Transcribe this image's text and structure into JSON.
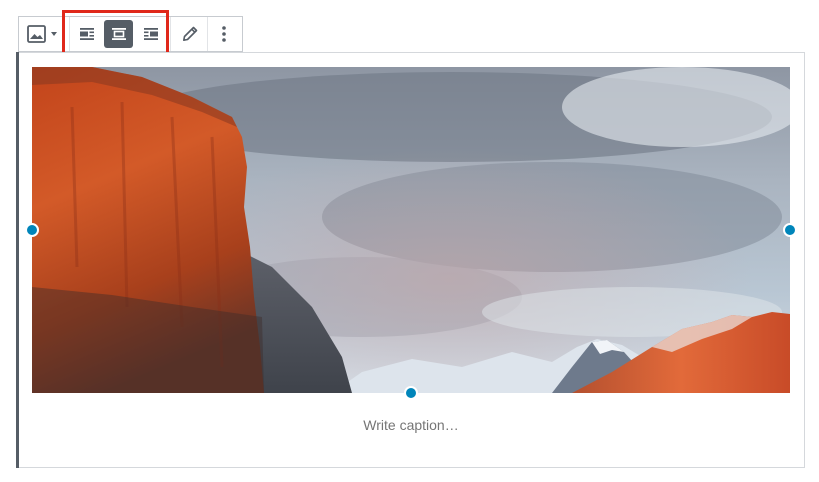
{
  "toolbar": {
    "buttons": [
      {
        "name": "change-image-type",
        "icon": "image-icon",
        "has_dropdown": true,
        "dropdown_icon": "caret-down-icon"
      },
      {
        "name": "align-left",
        "icon": "align-left-icon"
      },
      {
        "name": "align-center",
        "icon": "align-center-icon",
        "active": true
      },
      {
        "name": "align-right",
        "icon": "align-right-icon"
      },
      {
        "name": "edit-image",
        "icon": "pencil-icon"
      },
      {
        "name": "more-options",
        "icon": "vertical-ellipsis-icon"
      }
    ],
    "highlighted_group": "alignment-buttons"
  },
  "block": {
    "image_alt": "",
    "caption_placeholder": "Write caption…",
    "caption_value": ""
  },
  "colors": {
    "accent": "#0085ba",
    "active_button": "#555d66",
    "highlight_border": "#e0281a",
    "icon": "#555d66",
    "caption_placeholder": "#7e8993"
  }
}
